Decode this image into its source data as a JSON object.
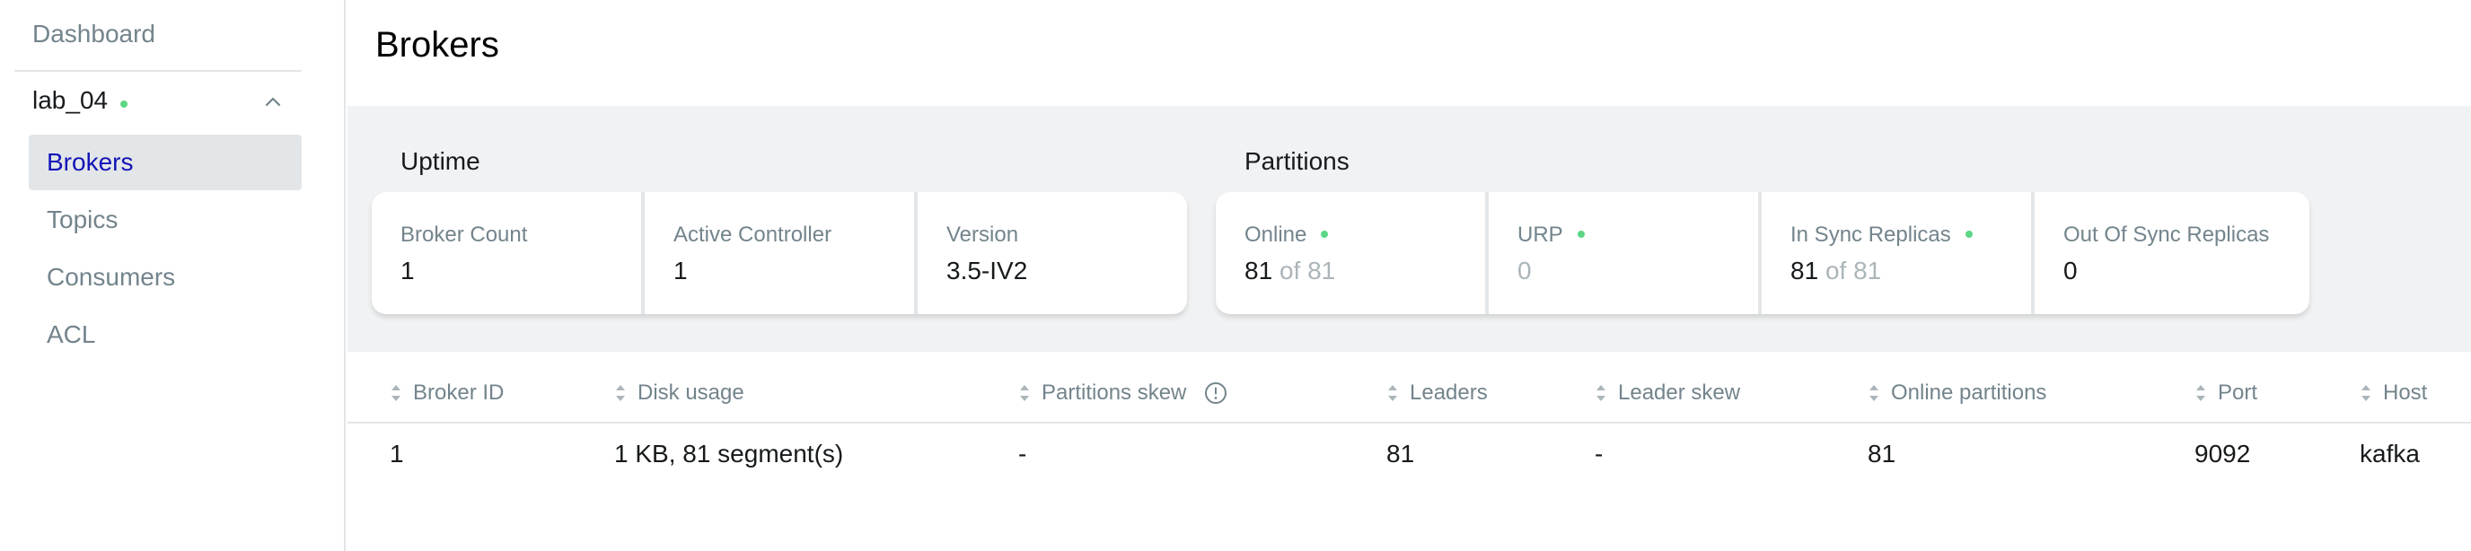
{
  "sidebar": {
    "dashboard": "Dashboard",
    "cluster": {
      "name": "lab_04",
      "status_color": "#5cd685"
    },
    "items": [
      {
        "label": "Brokers",
        "active": true
      },
      {
        "label": "Topics",
        "active": false
      },
      {
        "label": "Consumers",
        "active": false
      },
      {
        "label": "ACL",
        "active": false
      }
    ]
  },
  "page": {
    "title": "Brokers"
  },
  "uptime": {
    "title": "Uptime",
    "cards": [
      {
        "label": "Broker Count",
        "value": "1"
      },
      {
        "label": "Active Controller",
        "value": "1"
      },
      {
        "label": "Version",
        "value": "3.5-IV2"
      }
    ]
  },
  "partitions": {
    "title": "Partitions",
    "cards": [
      {
        "label": "Online",
        "value": "81",
        "suffix": "of 81"
      },
      {
        "label": "URP",
        "value": "0"
      },
      {
        "label": "In Sync Replicas",
        "value": "81",
        "suffix": "of 81"
      },
      {
        "label": "Out Of Sync Replicas",
        "value": "0"
      }
    ]
  },
  "table": {
    "columns": [
      "Broker ID",
      "Disk usage",
      "Partitions skew",
      "Leaders",
      "Leader skew",
      "Online partitions",
      "Port",
      "Host"
    ],
    "rows": [
      [
        "1",
        "1 KB, 81 segment(s)",
        "-",
        "81",
        "-",
        "81",
        "9092",
        "kafka"
      ]
    ]
  },
  "colors": {
    "accent": "#1414b8",
    "ok": "#5cd685",
    "muted": "#73848c"
  },
  "icons": {
    "chevron": "chevron-up-icon",
    "sort": "sort-icon",
    "info": "info-icon"
  }
}
